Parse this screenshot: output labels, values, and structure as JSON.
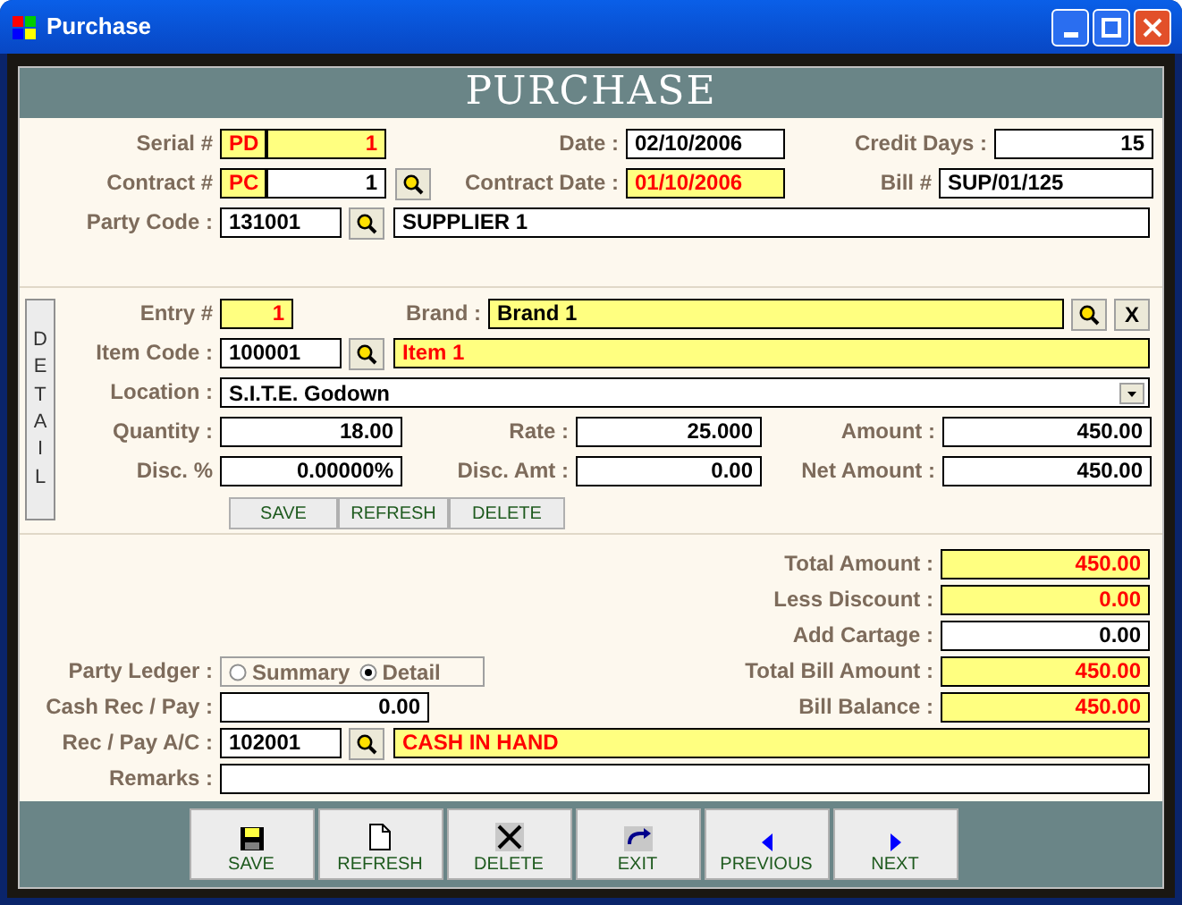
{
  "window": {
    "title": "Purchase"
  },
  "header": {
    "title": "PURCHASE"
  },
  "master": {
    "serial": {
      "label": "Serial #",
      "prefix": "PD",
      "value": "1",
      "highlighted": true
    },
    "date": {
      "label": "Date :",
      "value": "02/10/2006",
      "highlighted": false
    },
    "credit_days": {
      "label": "Credit Days :",
      "value": "15",
      "highlighted": false
    },
    "contract": {
      "label": "Contract #",
      "prefix": "PC",
      "prefix_highlighted": true,
      "value": "1",
      "highlighted": false
    },
    "contract_date": {
      "label": "Contract Date :",
      "value": "01/10/2006",
      "highlighted": true
    },
    "bill": {
      "label": "Bill #",
      "value": "SUP/01/125",
      "highlighted": false
    },
    "party": {
      "label": "Party Code :",
      "code": "131001",
      "name": "SUPPLIER 1",
      "highlighted": false
    }
  },
  "detail": {
    "tab": "DETAIL",
    "entry": {
      "label": "Entry #",
      "value": "1",
      "highlighted": true
    },
    "brand": {
      "label": "Brand :",
      "value": "Brand 1",
      "highlighted": true
    },
    "clear_button": "X",
    "item": {
      "label": "Item Code :",
      "code": "100001",
      "name": "Item 1",
      "highlighted": true
    },
    "location": {
      "label": "Location :",
      "value": "S.I.T.E. Godown"
    },
    "quantity": {
      "label": "Quantity :",
      "value": "18.00"
    },
    "rate": {
      "label": "Rate :",
      "value": "25.000"
    },
    "amount": {
      "label": "Amount :",
      "value": "450.00"
    },
    "disc_pct": {
      "label": "Disc. %",
      "value": "0.00000%"
    },
    "disc_amt": {
      "label": "Disc. Amt :",
      "value": "0.00"
    },
    "net_amount": {
      "label": "Net Amount :",
      "value": "450.00"
    },
    "buttons": [
      "SAVE",
      "REFRESH",
      "DELETE"
    ]
  },
  "totals": [
    {
      "label": "Total Amount :",
      "value": "450.00",
      "highlighted": true
    },
    {
      "label": "Less Discount :",
      "value": "0.00",
      "highlighted": true
    },
    {
      "label": "Add Cartage :",
      "value": "0.00",
      "highlighted": false
    },
    {
      "label": "Total Bill Amount :",
      "value": "450.00",
      "highlighted": true
    },
    {
      "label": "Bill Balance :",
      "value": "450.00",
      "highlighted": true
    }
  ],
  "party_ledger": {
    "label": "Party Ledger :",
    "options": [
      {
        "label": "Summary",
        "selected": false
      },
      {
        "label": "Detail",
        "selected": true
      }
    ]
  },
  "cash": {
    "label": "Cash Rec / Pay :",
    "value": "0.00"
  },
  "account": {
    "label": "Rec / Pay A/C :",
    "code": "102001",
    "name": "CASH IN HAND",
    "highlighted": true
  },
  "remarks": {
    "label": "Remarks :"
  },
  "toolbar": [
    {
      "kind": "save",
      "label": "SAVE"
    },
    {
      "kind": "refresh",
      "label": "REFRESH"
    },
    {
      "kind": "delete",
      "label": "DELETE"
    },
    {
      "kind": "exit",
      "label": "EXIT"
    },
    {
      "kind": "previous",
      "label": "PREVIOUS"
    },
    {
      "kind": "next",
      "label": "NEXT"
    }
  ]
}
